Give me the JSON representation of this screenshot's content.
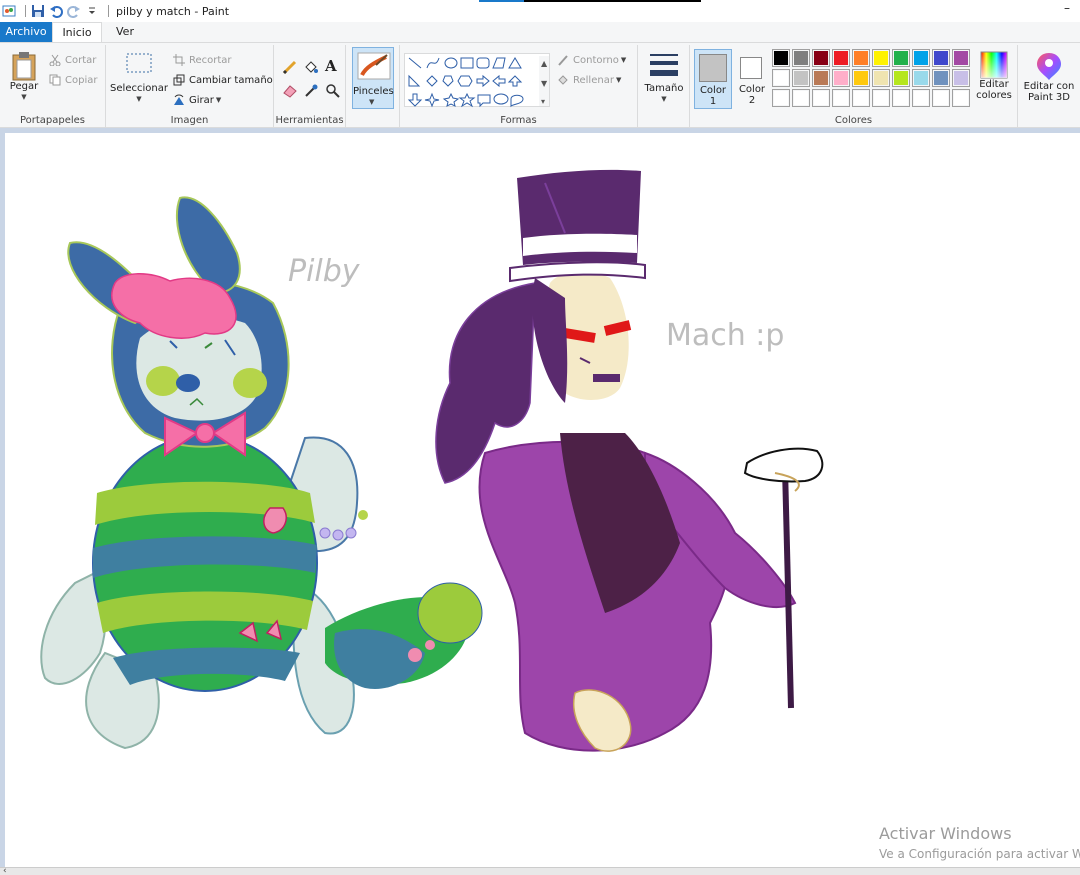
{
  "window": {
    "title": "pilby y match - Paint"
  },
  "tabs": {
    "file": "Archivo",
    "home": "Inicio",
    "view": "Ver"
  },
  "ribbon": {
    "clipboard": {
      "label": "Portapapeles",
      "paste": "Pegar",
      "cut": "Cortar",
      "copy": "Copiar"
    },
    "image": {
      "label": "Imagen",
      "select": "Seleccionar",
      "crop": "Recortar",
      "resize": "Cambiar tamaño",
      "rotate": "Girar"
    },
    "tools": {
      "label": "Herramientas"
    },
    "brushes": {
      "label": "Pinceles"
    },
    "shapes": {
      "label": "Formas",
      "outline": "Contorno",
      "fill": "Rellenar"
    },
    "size": {
      "label": "Tamaño"
    },
    "colors": {
      "label": "Colores",
      "color1": "Color",
      "color1_num": "1",
      "color2": "Color",
      "color2_num": "2",
      "edit": "Editar",
      "edit2": "colores",
      "paint3d": "Editar con",
      "paint3d2": "Paint 3D",
      "color1_value": "#c3c3c3",
      "color2_value": "#ffffff",
      "palette_row1": [
        "#000000",
        "#7f7f7f",
        "#880015",
        "#ed1c24",
        "#ff7f27",
        "#fff200",
        "#22b14c",
        "#00a2e8",
        "#3f48cc",
        "#a349a4"
      ],
      "palette_row2": [
        "#ffffff",
        "#c3c3c3",
        "#b97a57",
        "#ffaec9",
        "#ffc90e",
        "#efe4b0",
        "#b5e61d",
        "#99d9ea",
        "#7092be",
        "#c8bfe7"
      ],
      "palette_row3": [
        "#ffffff",
        "#ffffff",
        "#ffffff",
        "#ffffff",
        "#ffffff",
        "#ffffff",
        "#ffffff",
        "#ffffff",
        "#ffffff",
        "#ffffff"
      ]
    }
  },
  "canvas": {
    "label_pilby": "Pilby",
    "label_mach": "Mach :p"
  },
  "watermark": {
    "line1": "Activar Windows",
    "line2": "Ve a Configuración para activar W"
  }
}
